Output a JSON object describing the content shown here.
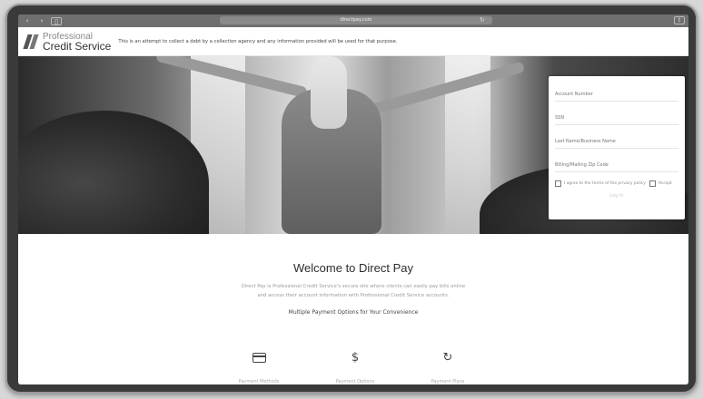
{
  "browser": {
    "address": "directpay.com",
    "back_icon": "chevron-left",
    "forward_icon": "chevron-right",
    "book_icon": "book",
    "reload_icon": "reload",
    "share_icon": "share"
  },
  "header": {
    "logo_line1": "Professional",
    "logo_line2": "Credit Service",
    "disclaimer": "This is an attempt to collect a debt by a collection agency and any information provided will be used for that purpose."
  },
  "login": {
    "account_placeholder": "Account Number",
    "ssn_placeholder": "SSN",
    "name_placeholder": "Last Name/Business Name",
    "zip_placeholder": "Billing/Mailing Zip Code",
    "check1_label": "I agree to the terms of the privacy policy",
    "check2_label": "Accept",
    "submit_label": "Log In"
  },
  "content": {
    "welcome_title": "Welcome to Direct Pay",
    "intro_line1": "Direct Pay is Professional Credit Service's secure site where clients can easily pay bills online",
    "intro_line2": "and access their account information with Professional Credit Service accounts.",
    "options_title": "Multiple Payment Options for Your Convenience"
  },
  "methods": [
    {
      "icon": "card",
      "label": "Payment Methods"
    },
    {
      "icon": "$",
      "label": "Payment Options"
    },
    {
      "icon": "↻",
      "label": "Payment Plans"
    }
  ],
  "colors": {
    "accent": "#333333",
    "muted": "#999999"
  }
}
